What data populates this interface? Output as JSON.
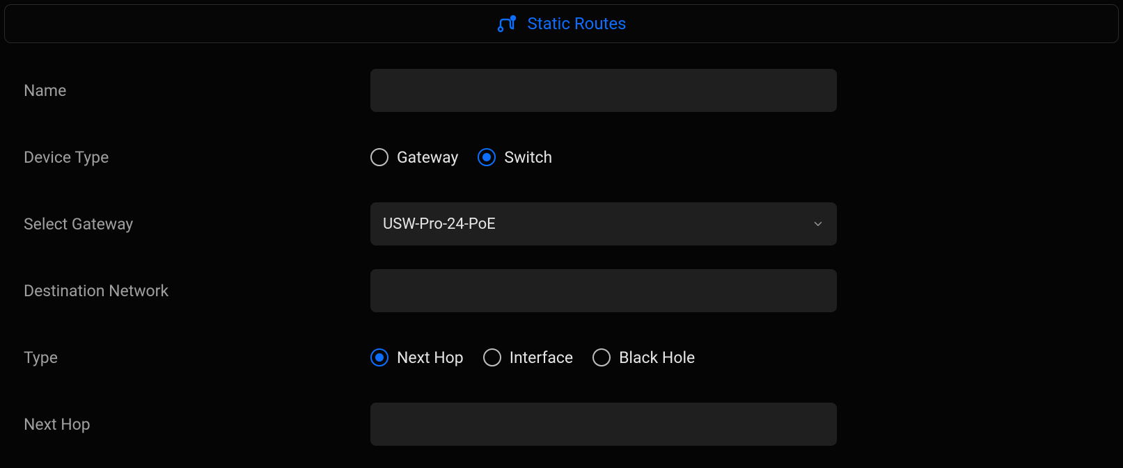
{
  "header": {
    "title": "Static Routes"
  },
  "form": {
    "name": {
      "label": "Name",
      "value": ""
    },
    "device_type": {
      "label": "Device Type",
      "options": [
        {
          "label": "Gateway",
          "selected": false
        },
        {
          "label": "Switch",
          "selected": true
        }
      ]
    },
    "select_gateway": {
      "label": "Select Gateway",
      "value": "USW-Pro-24-PoE"
    },
    "destination_network": {
      "label": "Destination Network",
      "value": ""
    },
    "type": {
      "label": "Type",
      "options": [
        {
          "label": "Next Hop",
          "selected": true
        },
        {
          "label": "Interface",
          "selected": false
        },
        {
          "label": "Black Hole",
          "selected": false
        }
      ]
    },
    "next_hop": {
      "label": "Next Hop",
      "value": ""
    }
  }
}
